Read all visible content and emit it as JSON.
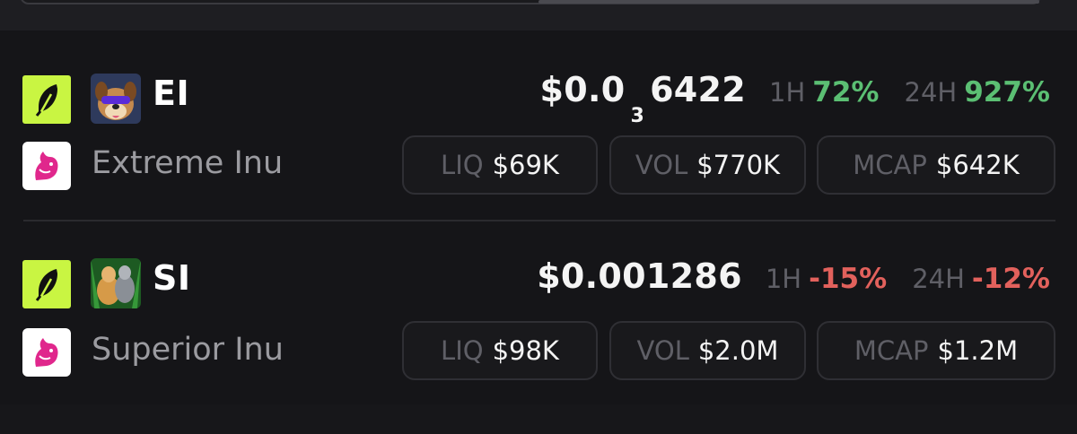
{
  "tokens": [
    {
      "symbol": "EI",
      "name": "Extreme Inu",
      "price_prefix": "$0.0",
      "price_zeros": "3",
      "price_digits": "6422",
      "h1_label": "1H",
      "h1_value": "72%",
      "h24_label": "24H",
      "h24_value": "927%",
      "liq_label": "LIQ",
      "liq_value": "$69K",
      "vol_label": "VOL",
      "vol_value": "$770K",
      "mcap_label": "MCAP",
      "mcap_value": "$642K"
    },
    {
      "symbol": "SI",
      "name": "Superior Inu",
      "price": "$0.001286",
      "h1_label": "1H",
      "h1_value": "-15%",
      "h24_label": "24H",
      "h24_value": "-12%",
      "liq_label": "LIQ",
      "liq_value": "$98K",
      "vol_label": "VOL",
      "vol_value": "$2.0M",
      "mcap_label": "MCAP",
      "mcap_value": "$1.2M"
    }
  ],
  "colors": {
    "positive": "#5bbf73",
    "negative": "#e2615c",
    "app_badge": "#c9f542",
    "background": "#151518"
  },
  "icons": {
    "app_badge": "feather-icon",
    "dex_badge": "unicorn-icon"
  }
}
